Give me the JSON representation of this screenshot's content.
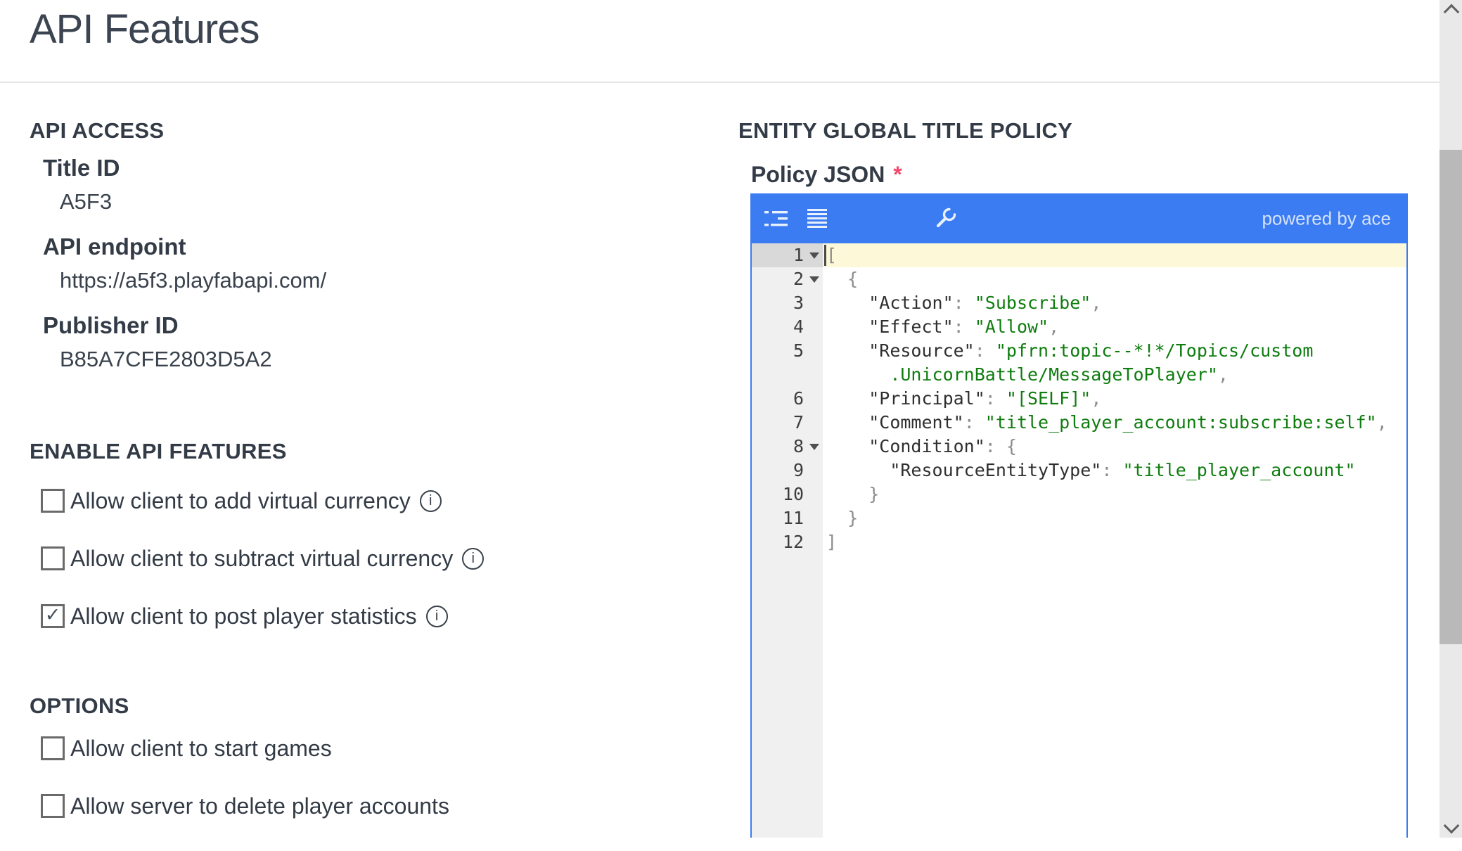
{
  "header": {
    "title": "API Features"
  },
  "api_access": {
    "heading": "API ACCESS",
    "fields": [
      {
        "label": "Title ID",
        "value": "A5F3"
      },
      {
        "label": "API endpoint",
        "value": "https://a5f3.playfabapi.com/"
      },
      {
        "label": "Publisher ID",
        "value": "B85A7CFE2803D5A2"
      }
    ]
  },
  "enable_api_features": {
    "heading": "ENABLE API FEATURES",
    "items": [
      {
        "label": "Allow client to add virtual currency",
        "checked": false,
        "info": true
      },
      {
        "label": "Allow client to subtract virtual currency",
        "checked": false,
        "info": true
      },
      {
        "label": "Allow client to post player statistics",
        "checked": true,
        "info": true
      }
    ]
  },
  "options": {
    "heading": "OPTIONS",
    "items": [
      {
        "label": "Allow client to start games",
        "checked": false,
        "info": false
      },
      {
        "label": "Allow server to delete player accounts",
        "checked": false,
        "info": false
      }
    ]
  },
  "policy": {
    "heading": "ENTITY GLOBAL TITLE POLICY",
    "field_label": "Policy JSON",
    "required_marker": "*",
    "editor": {
      "branding": "powered by ace",
      "toolbar_icons": [
        "indent-settings-icon",
        "align-lines-icon",
        "wrench-settings-icon"
      ],
      "rows": [
        {
          "n": "1",
          "fold": true,
          "active": true,
          "cursor": true,
          "segs": [
            [
              "pun",
              "["
            ]
          ]
        },
        {
          "n": "2",
          "fold": true,
          "segs": [
            [
              "pun",
              "  {"
            ]
          ]
        },
        {
          "n": "3",
          "segs": [
            [
              "def",
              "    "
            ],
            [
              "key",
              "\"Action\""
            ],
            [
              "pun",
              ": "
            ],
            [
              "str",
              "\"Subscribe\""
            ],
            [
              "pun",
              ","
            ]
          ]
        },
        {
          "n": "4",
          "segs": [
            [
              "def",
              "    "
            ],
            [
              "key",
              "\"Effect\""
            ],
            [
              "pun",
              ": "
            ],
            [
              "str",
              "\"Allow\""
            ],
            [
              "pun",
              ","
            ]
          ]
        },
        {
          "n": "5",
          "segs": [
            [
              "def",
              "    "
            ],
            [
              "key",
              "\"Resource\""
            ],
            [
              "pun",
              ": "
            ],
            [
              "str",
              "\"pfrn:topic--*!*/Topics/custom"
            ]
          ]
        },
        {
          "n": "",
          "segs": [
            [
              "def",
              "      "
            ],
            [
              "str",
              ".UnicornBattle/MessageToPlayer\""
            ],
            [
              "pun",
              ","
            ]
          ]
        },
        {
          "n": "6",
          "segs": [
            [
              "def",
              "    "
            ],
            [
              "key",
              "\"Principal\""
            ],
            [
              "pun",
              ": "
            ],
            [
              "str",
              "\"[SELF]\""
            ],
            [
              "pun",
              ","
            ]
          ]
        },
        {
          "n": "7",
          "segs": [
            [
              "def",
              "    "
            ],
            [
              "key",
              "\"Comment\""
            ],
            [
              "pun",
              ": "
            ],
            [
              "str",
              "\"title_player_account:subscribe:self\""
            ],
            [
              "pun",
              ","
            ]
          ]
        },
        {
          "n": "8",
          "fold": true,
          "segs": [
            [
              "def",
              "    "
            ],
            [
              "key",
              "\"Condition\""
            ],
            [
              "pun",
              ": {"
            ]
          ]
        },
        {
          "n": "9",
          "segs": [
            [
              "def",
              "      "
            ],
            [
              "key",
              "\"ResourceEntityType\""
            ],
            [
              "pun",
              ": "
            ],
            [
              "str",
              "\"title_player_account\""
            ]
          ]
        },
        {
          "n": "10",
          "segs": [
            [
              "pun",
              "    }"
            ]
          ]
        },
        {
          "n": "11",
          "segs": [
            [
              "pun",
              "  }"
            ]
          ]
        },
        {
          "n": "12",
          "segs": [
            [
              "pun",
              "]"
            ]
          ]
        }
      ]
    }
  },
  "icons": {
    "check_glyph": "✓",
    "info_glyph": "i"
  },
  "colors": {
    "accent_blue": "#3b7cf2",
    "required_red": "#f0496b",
    "string_green": "#0e7c0e",
    "active_line_yellow": "#fcf8d8"
  }
}
